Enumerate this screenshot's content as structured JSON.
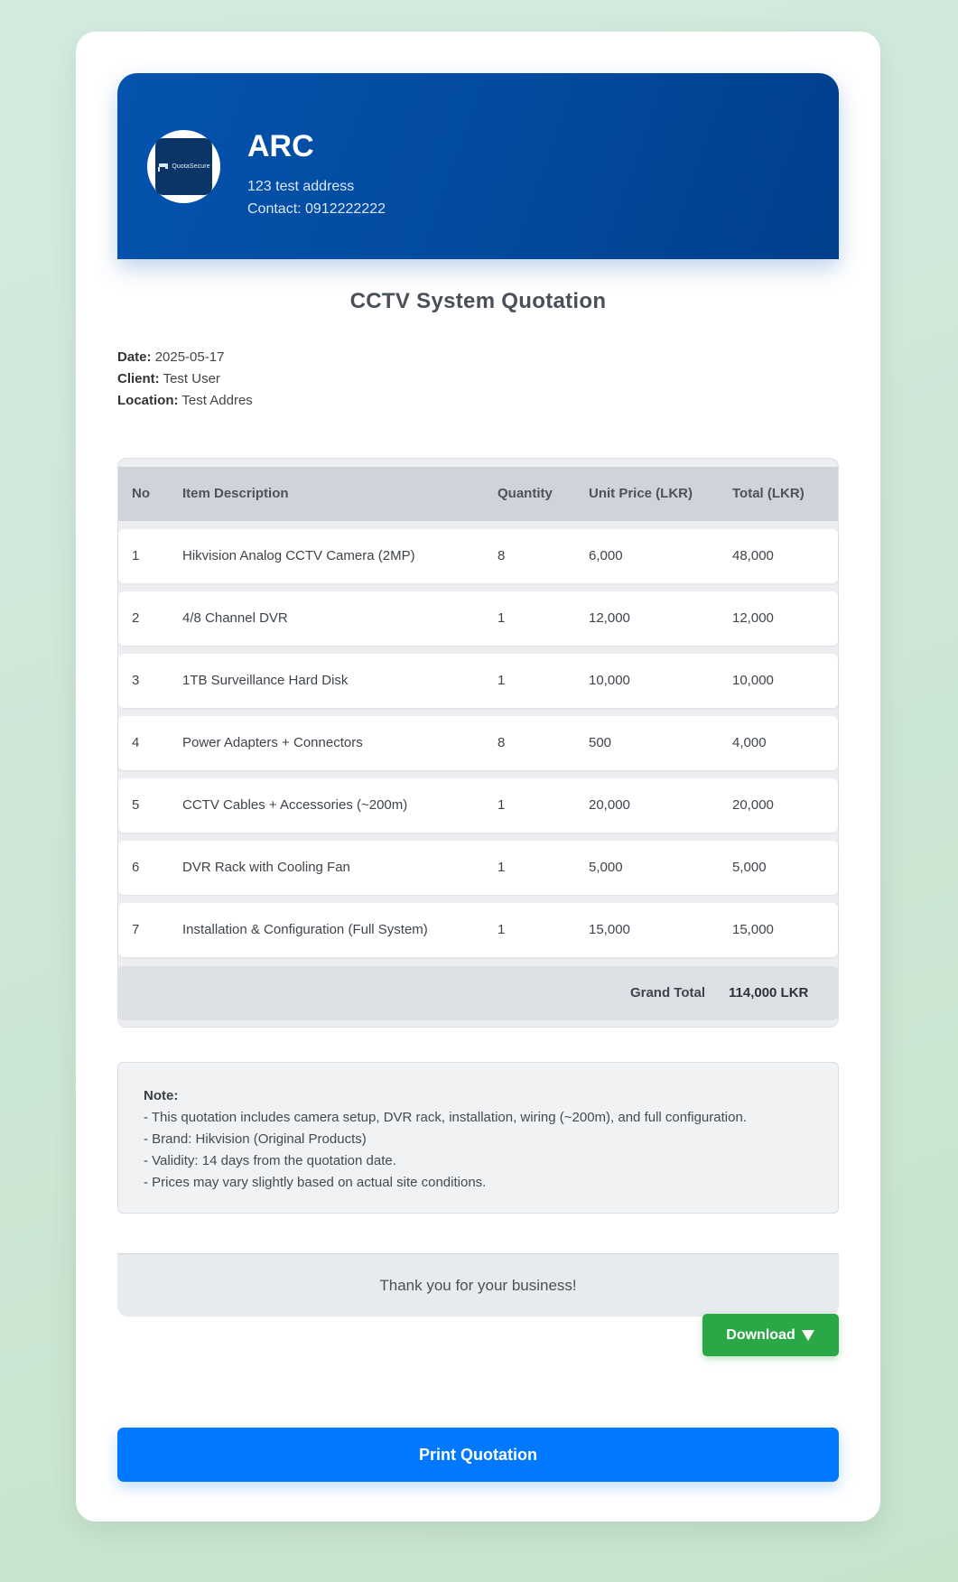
{
  "company": {
    "name": "ARC",
    "address": "123 test address",
    "contact": "Contact: 0912222222",
    "logo_text": "QuotaSecure",
    "logo_icon": "cctv-camera-icon"
  },
  "title": "CCTV System Quotation",
  "meta": {
    "date_label": "Date:",
    "date": "2025-05-17",
    "client_label": "Client:",
    "client": "Test User",
    "location_label": "Location:",
    "location": "Test Addres"
  },
  "table": {
    "headers": [
      "No",
      "Item Description",
      "Quantity",
      "Unit Price (LKR)",
      "Total (LKR)"
    ],
    "rows": [
      [
        "1",
        "Hikvision Analog CCTV Camera (2MP)",
        "8",
        "6,000",
        "48,000"
      ],
      [
        "2",
        "4/8 Channel DVR",
        "1",
        "12,000",
        "12,000"
      ],
      [
        "3",
        "1TB Surveillance Hard Disk",
        "1",
        "10,000",
        "10,000"
      ],
      [
        "4",
        "Power Adapters + Connectors",
        "8",
        "500",
        "4,000"
      ],
      [
        "5",
        "CCTV Cables + Accessories (~200m)",
        "1",
        "20,000",
        "20,000"
      ],
      [
        "6",
        "DVR Rack with Cooling Fan",
        "1",
        "5,000",
        "5,000"
      ],
      [
        "7",
        "Installation & Configuration (Full System)",
        "1",
        "15,000",
        "15,000"
      ]
    ],
    "grand_total_label": "Grand Total",
    "grand_total_value": "114,000 LKR"
  },
  "note": {
    "title": "Note:",
    "lines": [
      "- This quotation includes camera setup, DVR rack, installation, wiring (~200m), and full configuration.",
      "- Brand: Hikvision (Original Products)",
      "- Validity: 14 days from the quotation date.",
      "- Prices may vary slightly based on actual site conditions."
    ]
  },
  "footer": {
    "thanks": "Thank you for your business!"
  },
  "buttons": {
    "download_label": "Download",
    "download_icon": "down-arrow-icon",
    "print_label": "Print Quotation"
  },
  "colors": {
    "header_start": "#0553ae",
    "header_end": "#003f8c",
    "download": "#2aa845",
    "print": "#0078ff"
  }
}
